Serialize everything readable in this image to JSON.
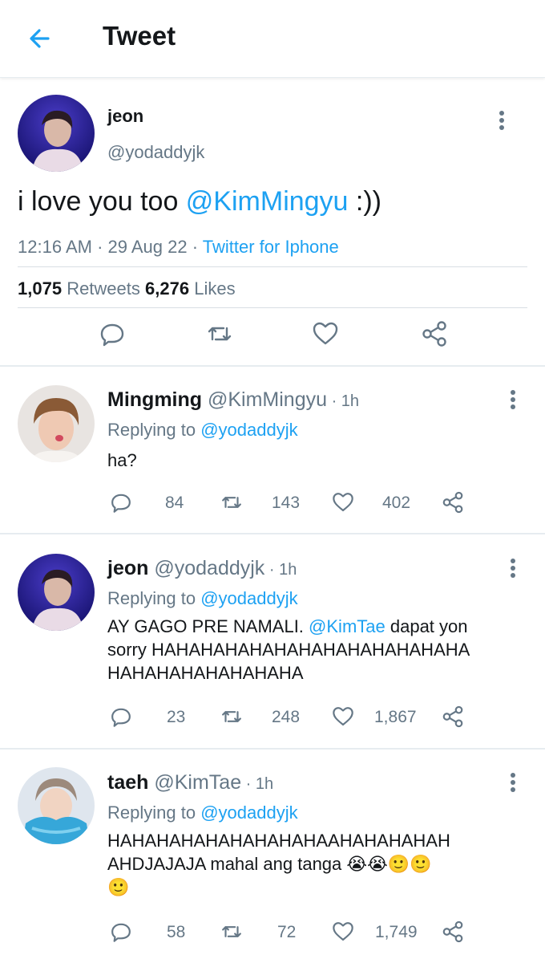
{
  "header": {
    "title": "Tweet"
  },
  "main_tweet": {
    "name": "jeon",
    "handle": "@yodaddyjk",
    "text_before": "i love you too ",
    "mention": "@KimMingyu",
    "text_after": " :))",
    "time": "12:16 AM",
    "date": "29 Aug 22",
    "source": "Twitter for Iphone",
    "retweets_count": "1,075",
    "retweets_label": "Retweets",
    "likes_count": "6,276",
    "likes_label": "Likes"
  },
  "replies": [
    {
      "name": "Mingming",
      "handle": "@KimMingyu",
      "time": "1h",
      "replying_label": "Replying to",
      "replying_to": "@yodaddyjk",
      "text": "ha?",
      "replies": "84",
      "retweets": "143",
      "likes": "402"
    },
    {
      "name": "jeon",
      "handle": "@yodaddyjk",
      "time": "1h",
      "replying_label": "Replying to",
      "replying_to": "@yodaddyjk",
      "text_line1_before": "AY GAGO PRE NAMALI. ",
      "text_mention": "@KimTae",
      "text_line1_after": " dapat yon",
      "text_line2": "sorry HAHAHAHAHAHAHAHAHAHAHAHAHA",
      "text_line3": "HAHAHAHAHAHAHAHA",
      "replies": "23",
      "retweets": "248",
      "likes": "1,867"
    },
    {
      "name": "taeh",
      "handle": "@KimTae",
      "time": "1h",
      "replying_label": "Replying to",
      "replying_to": "@yodaddyjk",
      "text_line1": "HAHAHAHAHAHAHAHAHAAHAHAHAHAH",
      "text_line2": "AHDJAJAJA mahal ang tanga ",
      "emojis_line2": "😭😭🙂🙂",
      "emojis_line3": "🙂",
      "replies": "58",
      "retweets": "72",
      "likes": "1,749"
    }
  ],
  "icons": [
    "back-arrow-icon",
    "more-vert-icon",
    "reply-icon",
    "retweet-icon",
    "like-icon",
    "share-icon"
  ],
  "colors": {
    "accent": "#1da1f2",
    "secondary_text": "#657786",
    "divider": "#e6ecf0"
  }
}
